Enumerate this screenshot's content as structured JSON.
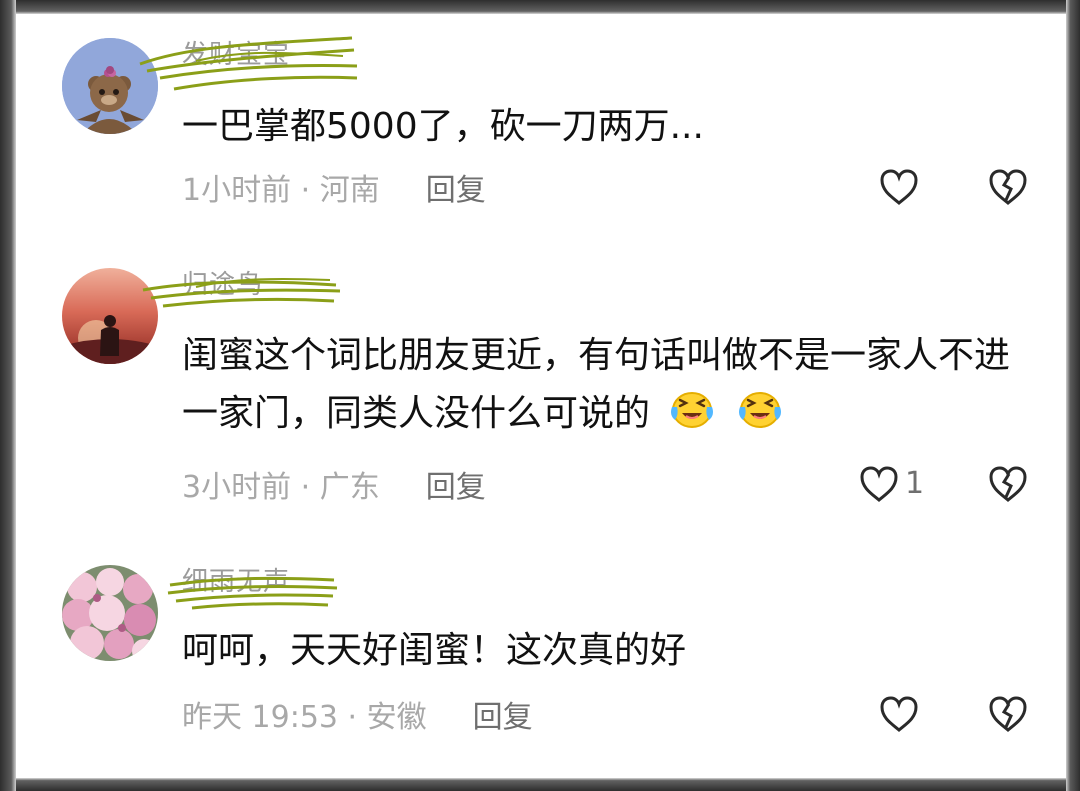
{
  "comments": [
    {
      "username": "发财宝宝",
      "text": "一巴掌都5000了，砍一刀两万...",
      "text_suffix": "",
      "meta": "1小时前 · 河南",
      "reply_label": "回复",
      "like_count": "",
      "avatar_icon": "bear-avatar-icon"
    },
    {
      "username": "归途鸟",
      "text": "闺蜜这个词比朋友更近，有句话叫做不是一家人不进一家门，同类人没什么可说的",
      "text_suffix": "😂😂",
      "meta": "3小时前 · 广东",
      "reply_label": "回复",
      "like_count": "1",
      "avatar_icon": "sunset-silhouette-avatar-icon"
    },
    {
      "username": "细雨无声",
      "text": "呵呵，天天好闺蜜！这次真的好",
      "text_suffix": "",
      "meta": "昨天 19:53 · 安徽",
      "reply_label": "回复",
      "like_count": "",
      "avatar_icon": "flower-avatar-icon"
    }
  ],
  "icons": {
    "like": "heart-outline-icon",
    "dislike": "broken-heart-icon",
    "emoji": "laughing-crying-emoji-icon"
  },
  "colors": {
    "text": "#111111",
    "meta": "#a8a8a8",
    "reply": "#6f6f6f",
    "scribble": "#8b9f18",
    "panel": "#ffffff",
    "frame": "#3a3a3a"
  }
}
